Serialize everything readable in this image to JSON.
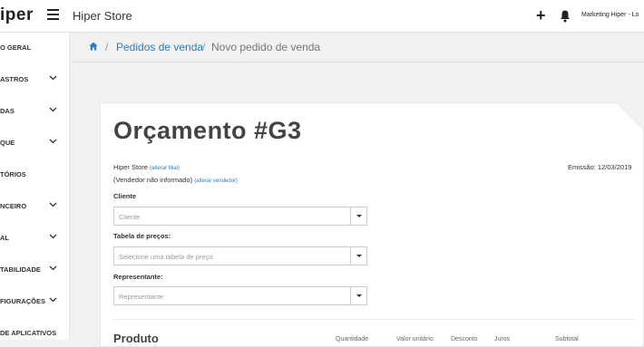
{
  "header": {
    "logo_text": "iper",
    "store_name": "Hiper Store",
    "user_label": "Marketing Hiper - Lo"
  },
  "sidebar": {
    "items": [
      {
        "label": "O GERAL",
        "has_chevron": false
      },
      {
        "label": "ASTROS",
        "has_chevron": true
      },
      {
        "label": "DAS",
        "has_chevron": true
      },
      {
        "label": "QUE",
        "has_chevron": true
      },
      {
        "label": "TÓRIOS",
        "has_chevron": false
      },
      {
        "label": "NCEIRO",
        "has_chevron": true
      },
      {
        "label": "AL",
        "has_chevron": true
      },
      {
        "label": "TABILIDADE",
        "has_chevron": true
      },
      {
        "label": "FIGURAÇÕES",
        "has_chevron": true
      },
      {
        "label": "DE APLICATIVOS",
        "has_chevron": false
      }
    ]
  },
  "breadcrumb": {
    "link": "Pedidos de venda",
    "current": "Novo pedido de venda",
    "separator": "/"
  },
  "order": {
    "title": "Orçamento #G3",
    "store": "Hiper Store",
    "change_store_link": "(alterar filial)",
    "seller": "(Vendedor não informado)",
    "change_seller_link": "(alterar vendedor)",
    "emission": "Emissão: 12/03/2019"
  },
  "fields": {
    "client_label": "Cliente",
    "client_placeholder": "Cliente",
    "price_table_label": "Tabela de preços:",
    "price_table_placeholder": "Selecione uma tabela de preço",
    "representative_label": "Representante:",
    "representative_placeholder": "Representante"
  },
  "products": {
    "heading": "Produto",
    "columns": [
      "Quantidade",
      "Valor unitário",
      "Desconto",
      "Juros",
      "Subtotal"
    ]
  },
  "colors": {
    "link": "#2a7ec0",
    "background": "#f1f1f1"
  }
}
